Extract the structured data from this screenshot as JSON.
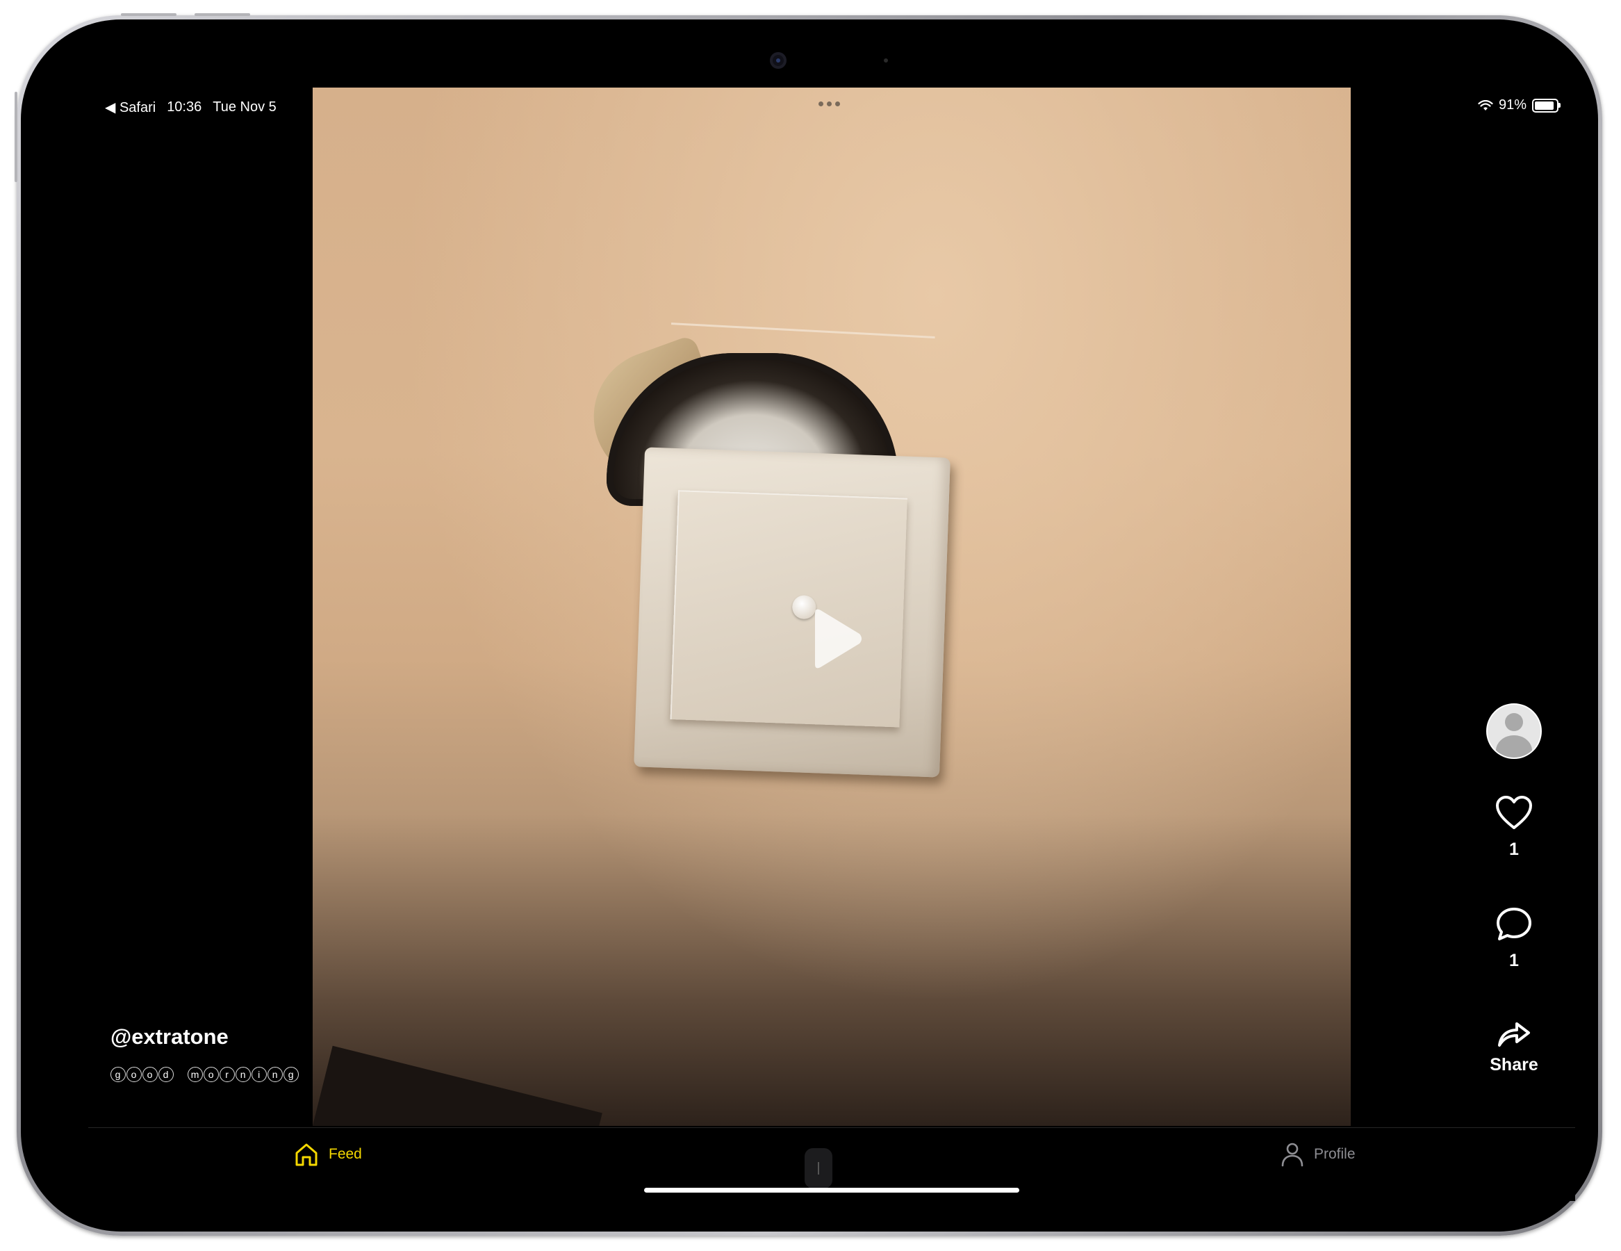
{
  "status_bar": {
    "back_app": "◀ Safari",
    "time": "10:36",
    "date": "Tue Nov 5",
    "battery": "91%",
    "battery_level": 0.91
  },
  "video": {
    "state": "paused",
    "play_icon": "play-icon"
  },
  "post": {
    "username": "@extratone",
    "description_letters": [
      "g",
      "o",
      "o",
      "d",
      " ",
      "m",
      "o",
      "r",
      "n",
      "i",
      "n",
      "g"
    ]
  },
  "actions": {
    "avatar_icon": "avatar",
    "like_icon": "heart-icon",
    "like_count": "1",
    "comment_icon": "comment-icon",
    "comment_count": "1",
    "share_icon": "share-icon",
    "share_label": "Share"
  },
  "tabbar": {
    "feed_label": "Feed",
    "profile_label": "Profile",
    "active_tab": "Feed",
    "active_color": "#f5d800",
    "inactive_color": "#8e8e93"
  }
}
